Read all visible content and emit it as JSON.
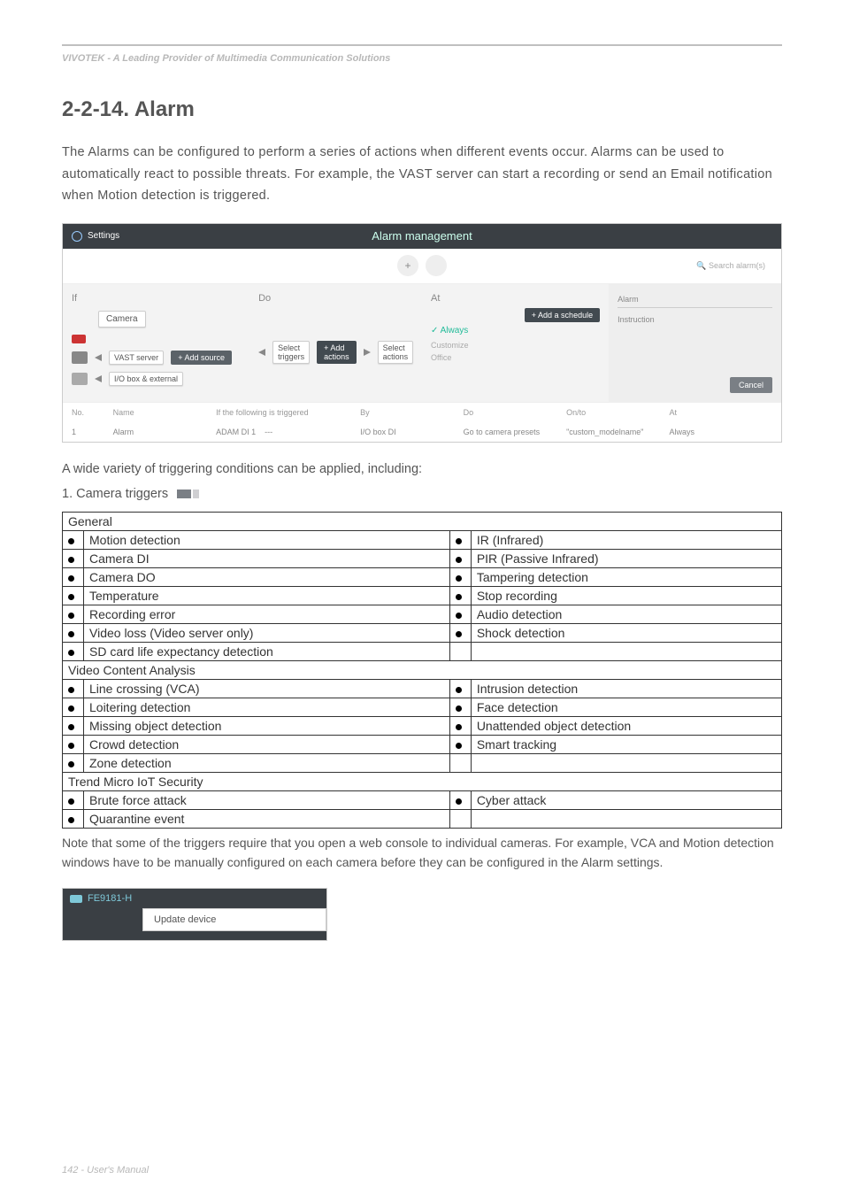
{
  "header_band": "VIVOTEK - A Leading Provider of Multimedia Communication Solutions",
  "section_title": "2-2-14. Alarm",
  "intro": "The Alarms can be configured to perform a series of actions when different events occur. Alarms can be used to automatically react to possible threats. For example, the VAST server can start a recording or send an Email notification when Motion detection is triggered.",
  "screenshot": {
    "settings": "Settings",
    "title": "Alarm management",
    "search": "Search alarm(s)",
    "plus": "+",
    "cols": {
      "if": "If",
      "do": "Do",
      "at": "At"
    },
    "if": {
      "camera": "Camera",
      "vast": "VAST server",
      "iobox": "I/O box & external",
      "add_source": "+  Add source"
    },
    "do": {
      "select_triggers": "Select triggers",
      "add_actions": "+  Add actions",
      "select_actions": "Select actions"
    },
    "at": {
      "add_schedule": "+  Add a schedule",
      "always": "✓  Always",
      "customize": "Customize",
      "office": "Office"
    },
    "right": {
      "alarm": "Alarm",
      "instruction": "Instruction",
      "cancel": "Cancel"
    },
    "table": {
      "head": {
        "no": "No.",
        "name": "Name",
        "if": "If the following is triggered",
        "by": "By",
        "do": "Do",
        "onto": "On/to",
        "at": "At"
      },
      "row": {
        "no": "1",
        "name": "Alarm",
        "if": "ADAM DI 1",
        "dash": "---",
        "by": "I/O box DI",
        "do": "Go to camera presets",
        "onto": "\"custom_modelname\"",
        "at": "Always"
      }
    }
  },
  "subhead": "A wide variety of triggering conditions can be applied, including:",
  "camera_triggers_label": "1. Camera triggers",
  "groups": {
    "general": "General",
    "vca": "Video Content Analysis",
    "iot": "Trend Micro IoT Security"
  },
  "triggers": {
    "general": [
      [
        "Motion detection",
        "IR (Infrared)"
      ],
      [
        "Camera DI",
        "PIR (Passive Infrared)"
      ],
      [
        "Camera DO",
        "Tampering detection"
      ],
      [
        "Temperature",
        "Stop recording"
      ],
      [
        "Recording error",
        "Audio detection"
      ],
      [
        "Video loss (Video server only)",
        "Shock detection"
      ],
      [
        "SD card life expectancy detection",
        ""
      ]
    ],
    "vca": [
      [
        "Line crossing (VCA)",
        "Intrusion detection"
      ],
      [
        "Loitering detection",
        "Face detection"
      ],
      [
        "Missing object detection",
        "Unattended object detection"
      ],
      [
        "Crowd detection",
        "Smart tracking"
      ],
      [
        "Zone detection",
        ""
      ]
    ],
    "iot": [
      [
        "Brute force attack",
        "Cyber attack"
      ],
      [
        "Quarantine event",
        ""
      ]
    ]
  },
  "note": "Note that some of the triggers require that you open a web console to individual cameras. For example, VCA and Motion detection windows have to be manually configured on each camera before they can be configured in the Alarm settings.",
  "mini": {
    "device": "FE9181-H",
    "update": "Update device"
  },
  "footer": "142 - User's Manual"
}
